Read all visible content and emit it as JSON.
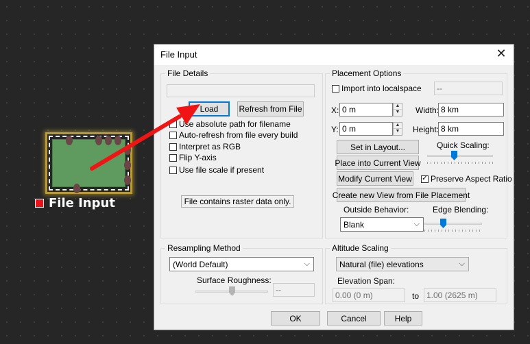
{
  "canvas": {
    "node_label": "File Input"
  },
  "dialog": {
    "title": "File Input",
    "close_icon": "close-x-icon",
    "file_details": {
      "label": "File Details",
      "filename": "",
      "load": "Load",
      "refresh": "Refresh from File",
      "options": [
        {
          "label": "Use absolute path for filename",
          "checked": false
        },
        {
          "label": "Auto-refresh from file every build",
          "checked": false
        },
        {
          "label": "Interpret as RGB",
          "checked": false
        },
        {
          "label": "Flip Y-axis",
          "checked": false
        },
        {
          "label": "Use file scale if present",
          "checked": false
        }
      ],
      "status": "File contains raster data only."
    },
    "placement": {
      "label": "Placement Options",
      "import_localspace": "Import into localspace",
      "import_checked": false,
      "localspace_value": "--",
      "x_label": "X:",
      "x_value": "0 m",
      "y_label": "Y:",
      "y_value": "0 m",
      "width_label": "Width:",
      "width_value": "8 km",
      "height_label": "Height:",
      "height_value": "8 km",
      "set_in_layout": "Set in Layout...",
      "place_into_view": "Place into Current View",
      "modify_view": "Modify Current View",
      "create_view": "Create new View from File Placement",
      "quick_scaling": "Quick Scaling:",
      "quick_scaling_level": 0.4,
      "preserve_aspect": "Preserve Aspect Ratio",
      "preserve_checked": true,
      "outside_behavior_label": "Outside Behavior:",
      "outside_behavior_value": "Blank",
      "edge_blending_label": "Edge Blending:",
      "edge_blending_level": 0.3
    },
    "resampling": {
      "label": "Resampling Method",
      "value": "(World Default)",
      "roughness_label": "Surface Roughness:",
      "roughness_value": "--",
      "roughness_level": 0.5
    },
    "altitude": {
      "label": "Altitude Scaling",
      "value": "Natural (file) elevations",
      "span_label": "Elevation Span:",
      "span_from": "0.00 (0 m)",
      "to_label": "to",
      "span_to": "1.00 (2625 m)"
    },
    "buttons": {
      "ok": "OK",
      "cancel": "Cancel",
      "help": "Help"
    }
  }
}
